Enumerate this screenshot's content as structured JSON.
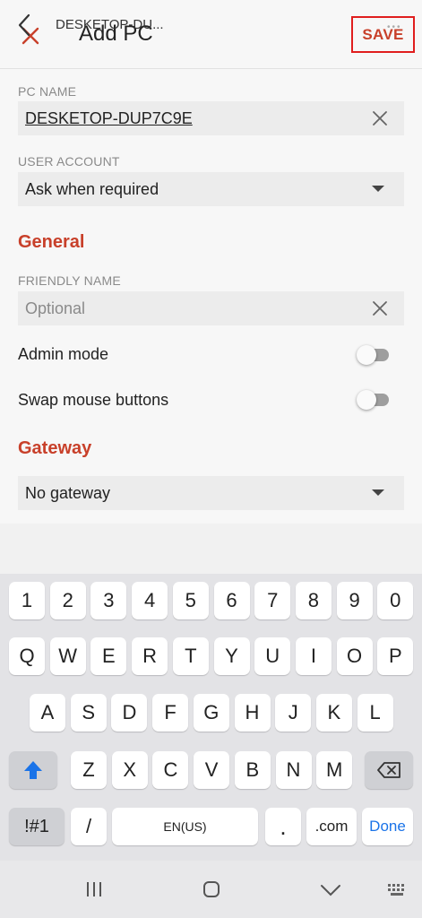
{
  "appbar": {
    "title": "Add PC",
    "save_label": "SAVE",
    "close_icon": "close-icon"
  },
  "pc_name": {
    "label": "PC NAME",
    "value": "DESKETOP-DUP7C9E"
  },
  "user_account": {
    "label": "USER ACCOUNT",
    "value": "Ask when required"
  },
  "general": {
    "heading": "General",
    "friendly_name": {
      "label": "FRIENDLY NAME",
      "placeholder": "Optional"
    },
    "admin_mode": {
      "label": "Admin mode",
      "enabled": false
    },
    "swap_mouse": {
      "label": "Swap mouse buttons",
      "enabled": false
    }
  },
  "gateway": {
    "heading": "Gateway",
    "value": "No gateway"
  },
  "suggestion_bar": {
    "text": "DESKETOP-DU...",
    "more": "•••"
  },
  "keyboard": {
    "row_numbers": [
      "1",
      "2",
      "3",
      "4",
      "5",
      "6",
      "7",
      "8",
      "9",
      "0"
    ],
    "row_q": [
      "Q",
      "W",
      "E",
      "R",
      "T",
      "Y",
      "U",
      "I",
      "O",
      "P"
    ],
    "row_a": [
      "A",
      "S",
      "D",
      "F",
      "G",
      "H",
      "J",
      "K",
      "L"
    ],
    "row_z": [
      "Z",
      "X",
      "C",
      "V",
      "B",
      "N",
      "M"
    ],
    "symbols_label": "!#1",
    "slash_label": "/",
    "space_label": "EN(US)",
    "dot_label": ".",
    "dotcom_label": ".com",
    "done_label": "Done"
  },
  "colors": {
    "accent": "#c8402a",
    "highlight_border": "#e01e1e",
    "done_blue": "#1a73e8",
    "shift_blue": "#1a73e8"
  }
}
